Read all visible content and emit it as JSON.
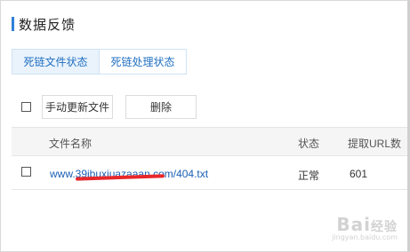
{
  "header": {
    "title": "数据反馈"
  },
  "tabs": [
    {
      "label": "死链文件状态",
      "active": true
    },
    {
      "label": "死链处理状态",
      "active": false
    }
  ],
  "toolbar": {
    "update_label": "手动更新文件",
    "delete_label": "删除"
  },
  "table": {
    "columns": [
      "文件名称",
      "状态",
      "提取URL数"
    ],
    "rows": [
      {
        "url": "www.39ibuxiuazaaan.com/404.txt",
        "status": "正常",
        "count": "601"
      }
    ]
  },
  "watermark": {
    "main": "Bai经验",
    "sub": "jingyan.baidu.com"
  },
  "colors": {
    "accent": "#2f7fd8",
    "link": "#1a5fb4",
    "redaction": "#e8282b"
  }
}
